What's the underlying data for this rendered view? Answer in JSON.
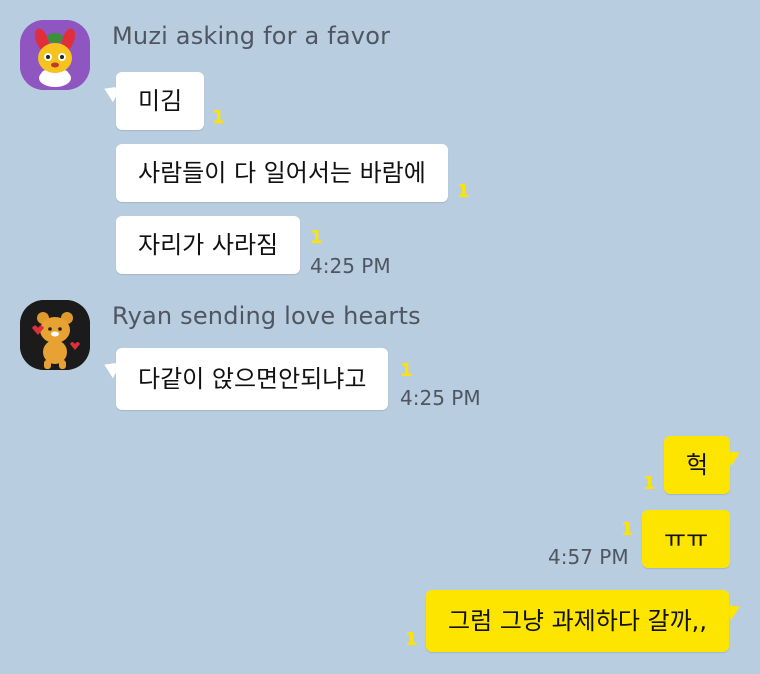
{
  "groups": [
    {
      "sender": "Muzi asking for a favor",
      "avatar_icon": "muzi-character-icon",
      "avatar_bg": "#8f55c0",
      "messages": [
        {
          "text": "미김",
          "unread": "1"
        },
        {
          "text": "사람들이 다 일어서는 바람에",
          "unread": "1"
        },
        {
          "text": "자리가 사라짐",
          "unread": "1",
          "time": "4:25 PM"
        }
      ]
    },
    {
      "sender": "Ryan sending love hearts",
      "avatar_icon": "ryan-character-icon",
      "avatar_bg": "#1b1b1b",
      "messages": [
        {
          "text": "다같이 앉으면안되냐고",
          "unread": "1",
          "time": "4:25 PM"
        }
      ]
    }
  ],
  "outgoing": [
    {
      "text": "헉",
      "unread": "1"
    },
    {
      "text": "ㅠㅠ",
      "unread": "1",
      "time": "4:57 PM"
    },
    {
      "text": "그럼 그냥 과제하다 갈까,,",
      "unread": "1"
    }
  ],
  "colors": {
    "background": "#b9cde0",
    "incoming_bubble": "#ffffff",
    "outgoing_bubble": "#fee500",
    "unread_count": "#ffe300",
    "meta_text": "#4f5660"
  }
}
